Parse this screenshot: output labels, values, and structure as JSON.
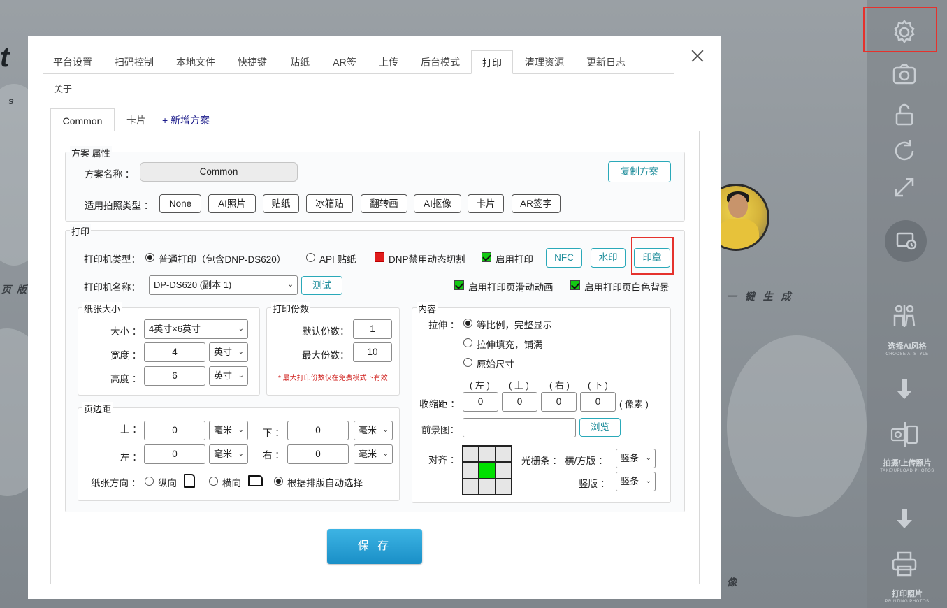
{
  "background": {
    "right_bar": {
      "items": [
        {
          "icon": "gear-icon"
        },
        {
          "icon": "camera-icon"
        },
        {
          "icon": "unlock-icon"
        },
        {
          "icon": "refresh-icon"
        },
        {
          "icon": "expand-icon"
        },
        {
          "icon": "gallery-clock-icon"
        },
        {
          "icon": "people-icon",
          "label": "选择AI风格",
          "sub": "CHOOSE AI STYLE"
        },
        {
          "icon": "arrow-down-icon"
        },
        {
          "icon": "photo-upload-icon",
          "label": "拍摄/上传照片",
          "sub": "TAKE/UPLOAD PHOTOS"
        },
        {
          "icon": "arrow-down-icon"
        },
        {
          "icon": "printer-icon",
          "label": "打印照片",
          "sub": "PRINTING PHOTOS"
        }
      ]
    },
    "left_fragments": [
      "s",
      "t",
      "版",
      "页"
    ],
    "right_fragment": "一 键 生 成",
    "bottom_fragment": "像"
  },
  "tabs": {
    "items": [
      "平台设置",
      "扫码控制",
      "本地文件",
      "快捷键",
      "贴纸",
      "AR签",
      "上传",
      "后台模式",
      "打印",
      "清理资源",
      "更新日志"
    ],
    "active": "打印",
    "second_row": "关于"
  },
  "sub_tabs": {
    "items": [
      "Common",
      "卡片"
    ],
    "add_label": "+ 新增方案",
    "active": "Common"
  },
  "scheme": {
    "group_title": "方案 属性",
    "name_label": "方案名称 ：",
    "name_value": "Common",
    "copy_button": "复制方案",
    "photo_type_label": "适用拍照类型 ：",
    "photo_types": [
      "None",
      "AI照片",
      "贴纸",
      "冰箱贴",
      "翻转画",
      "AI抠像",
      "卡片",
      "AR签字"
    ]
  },
  "print": {
    "group_title": "打印",
    "printer_type_label": "打印机类型：",
    "printer_type_options": [
      "普通打印（包含DNP-DS620）",
      "API 贴纸"
    ],
    "printer_type_selected": "普通打印（包含DNP-DS620）",
    "dnp_label": "DNP禁用动态切割",
    "enable_print_label": "启用打印",
    "nfc_button": "NFC",
    "watermark_button": "水印",
    "stamp_button": "印章",
    "printer_name_label": "打印机名称：",
    "printer_name_value": "DP-DS620 (副本 1)",
    "test_button": "测试",
    "slide_anim_label": "启用打印页滑动动画",
    "white_bg_label": "启用打印页白色背景"
  },
  "paper": {
    "group_title": "纸张大小",
    "size_label": "大小 ：",
    "size_value": "4英寸×6英寸",
    "width_label": "宽度 ：",
    "width_value": "4",
    "width_unit": "英寸",
    "height_label": "高度 ：",
    "height_value": "6",
    "height_unit": "英寸"
  },
  "copies": {
    "group_title": "打印份数",
    "default_label": "默认份数：",
    "default_value": "1",
    "max_label": "最大份数：",
    "max_value": "10",
    "note": "* 最大打印份数仅在免费模式下有效"
  },
  "margins": {
    "group_title": "页边距",
    "top_label": "上 ：",
    "top_value": "0",
    "top_unit": "毫米",
    "bottom_label": "下 ：",
    "bottom_value": "0",
    "bottom_unit": "毫米",
    "left_label": "左 ：",
    "left_value": "0",
    "left_unit": "毫米",
    "right_label": "右 ：",
    "right_value": "0",
    "right_unit": "毫米",
    "orientation_label": "纸张方向 ：",
    "orientation_options": [
      "纵向",
      "横向",
      "根据排版自动选择"
    ],
    "orientation_selected": "根据排版自动选择"
  },
  "content": {
    "group_title": "内容",
    "stretch_label": "拉伸 ：",
    "stretch_options": [
      "等比例，完整显示",
      "拉伸填充，铺满",
      "原始尺寸"
    ],
    "stretch_selected": "等比例，完整显示",
    "shrink_headers": [
      "( 左 )",
      "( 上 )",
      "( 右 )",
      "( 下 )"
    ],
    "shrink_label": "收缩距 ：",
    "shrink_values": [
      "0",
      "0",
      "0",
      "0"
    ],
    "shrink_unit": "( 像素 )",
    "foreground_label": "前景图：",
    "foreground_value": "",
    "browse_button": "浏览",
    "align_label": "对齐 ：",
    "align_selected_index": 4,
    "grating_label": "光栅条 ：",
    "landscape_label": "横/方版 ：",
    "landscape_value": "竖条",
    "portrait_label": "竖版 ：",
    "portrait_value": "竖条"
  },
  "save_button": "保 存",
  "colors": {
    "accent_teal": "#2aa9b9",
    "save_blue": "#1a8fc7",
    "highlight_red": "#e5322d",
    "check_green": "#13c913",
    "dnp_red": "#e01c1c",
    "align_green": "#00e000"
  }
}
